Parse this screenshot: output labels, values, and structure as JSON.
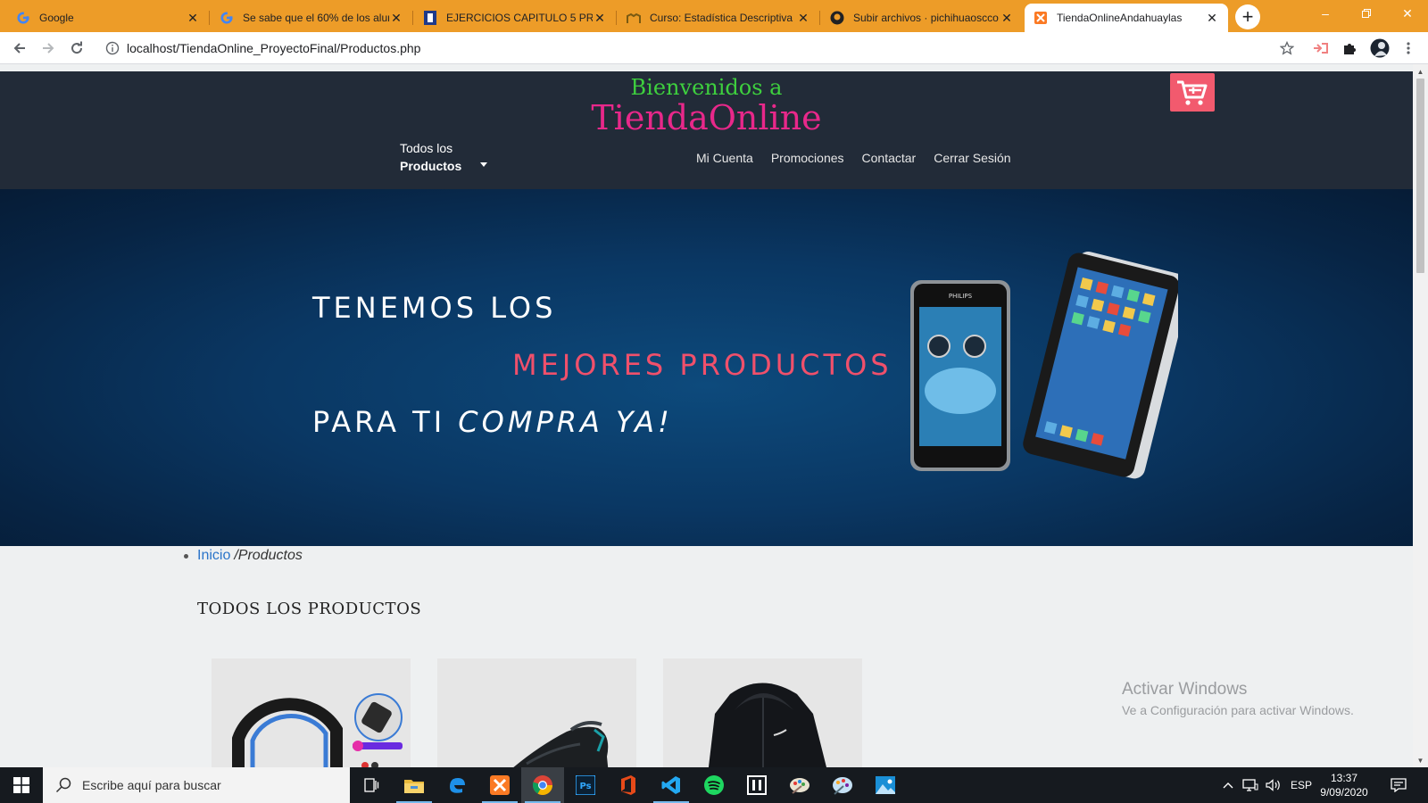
{
  "browser": {
    "tabs": [
      {
        "title": "Google",
        "icon": "google-icon"
      },
      {
        "title": "Se sabe que el 60% de los alum",
        "icon": "google-icon"
      },
      {
        "title": "EJERCICIOS CAPITULO 5 PROB",
        "icon": "document-icon"
      },
      {
        "title": "Curso: Estadística Descriptiva",
        "icon": "moodle-icon"
      },
      {
        "title": "Subir archivos · pichihuaoscco",
        "icon": "github-icon"
      },
      {
        "title": "TiendaOnlineAndahuaylas",
        "icon": "xampp-icon"
      }
    ],
    "url": "localhost/TiendaOnline_ProyectoFinal/Productos.php"
  },
  "site": {
    "welcome": "Bienvenidos a",
    "brand": "TiendaOnline",
    "menu_all_line1": "Todos los",
    "menu_all_line2": "Productos",
    "nav": [
      "Mi Cuenta",
      "Promociones",
      "Contactar",
      "Cerrar Sesión"
    ],
    "hero": {
      "line1": "TENEMOS LOS",
      "line2": "MEJORES PRODUCTOS",
      "line3a": "PARA TI ",
      "line3b": "COMPRA YA!"
    },
    "breadcrumb": {
      "home": "Inicio",
      "current": "/Productos"
    },
    "section_title": "TODOS LOS PRODUCTOS",
    "products": [
      {
        "image": "headphones"
      },
      {
        "image": "sneaker"
      },
      {
        "image": "jacket"
      }
    ],
    "colors": {
      "header_bg": "#222b38",
      "welcome": "#3ecf3e",
      "brand": "#e8288a",
      "cart": "#f25a6e",
      "hero_accent": "#f0506b"
    }
  },
  "watermark": {
    "title": "Activar Windows",
    "subtitle": "Ve a Configuración para activar Windows."
  },
  "taskbar": {
    "search_placeholder": "Escribe aquí para buscar",
    "apps": [
      "task-view",
      "file-explorer",
      "edge",
      "xampp",
      "chrome",
      "photoshop",
      "office",
      "vscode",
      "spotify",
      "app",
      "paint",
      "paint-3d",
      "photos"
    ],
    "lang": "ESP",
    "time": "13:37",
    "date": "9/09/2020"
  }
}
